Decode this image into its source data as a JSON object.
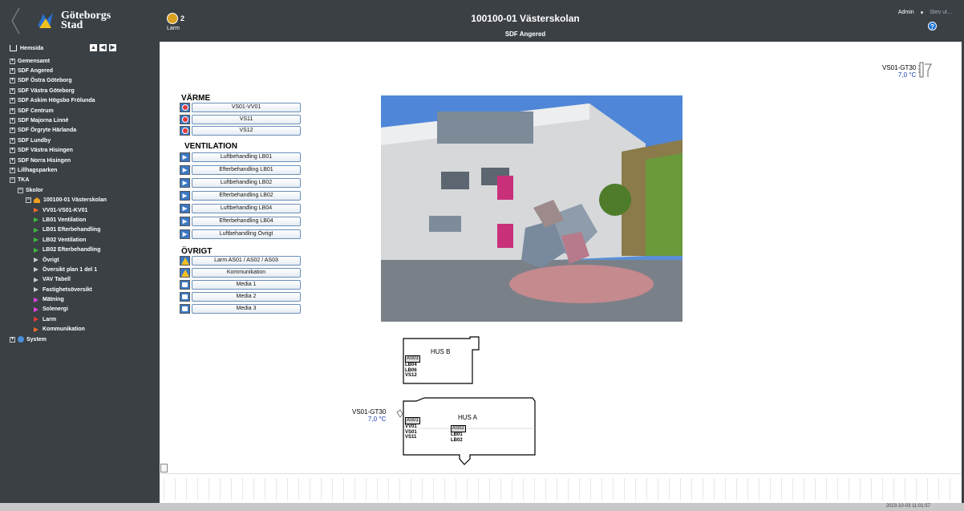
{
  "header": {
    "logo_line1": "Göteborgs",
    "logo_line2": "Stad",
    "alarm_count": "2",
    "alarm_label": "Larm",
    "title": "100100-01 Västerskolan",
    "subtitle": "SDF Angered",
    "user": "Admin",
    "logout": "Stev ut…"
  },
  "sidebar": {
    "home_label": "Hemsida",
    "tree": [
      {
        "label": "Gemensamt",
        "kind": "pm",
        "indent": 0
      },
      {
        "label": "SDF Angered",
        "kind": "pm",
        "indent": 0
      },
      {
        "label": "SDF Östra Göteborg",
        "kind": "pm",
        "indent": 0
      },
      {
        "label": "SDF Västra Göteborg",
        "kind": "pm",
        "indent": 0
      },
      {
        "label": "SDF Askim Högsbo Frölunda",
        "kind": "pm",
        "indent": 0
      },
      {
        "label": "SDF Centrum",
        "kind": "pm",
        "indent": 0
      },
      {
        "label": "SDF Majorna Linné",
        "kind": "pm",
        "indent": 0
      },
      {
        "label": "SDF Örgryte Härlanda",
        "kind": "pm",
        "indent": 0
      },
      {
        "label": "SDF Lundby",
        "kind": "pm",
        "indent": 0
      },
      {
        "label": "SDF Västra Hisingen",
        "kind": "pm",
        "indent": 0
      },
      {
        "label": "SDF Norra Hisingen",
        "kind": "pm",
        "indent": 0
      },
      {
        "label": "Lillhagsparken",
        "kind": "pm",
        "indent": 0
      },
      {
        "label": "TKA",
        "kind": "pm",
        "indent": 0
      },
      {
        "label": "Skolor",
        "kind": "pm",
        "indent": 1
      },
      {
        "label": "100100-01 Västerskolan",
        "kind": "bld",
        "indent": 2
      },
      {
        "label": "VV01-VS01-KV01",
        "kind": "tri",
        "color": "#f06a2a",
        "indent": 3
      },
      {
        "label": "LB01 Ventilation",
        "kind": "tri",
        "color": "#3dbb3d",
        "indent": 3
      },
      {
        "label": "LB01 Efterbehandling",
        "kind": "tri",
        "color": "#3dbb3d",
        "indent": 3
      },
      {
        "label": "LB02 Ventilation",
        "kind": "tri",
        "color": "#3dbb3d",
        "indent": 3
      },
      {
        "label": "LB02 Efterbehandling",
        "kind": "tri",
        "color": "#3dbb3d",
        "indent": 3
      },
      {
        "label": "Övrigt",
        "kind": "tri",
        "color": "#cccccc",
        "indent": 3
      },
      {
        "label": "Översikt plan 1 del 1",
        "kind": "tri",
        "color": "#cccccc",
        "indent": 3
      },
      {
        "label": "VAV Tabell",
        "kind": "tri",
        "color": "#cccccc",
        "indent": 3
      },
      {
        "label": "Fastighetsöversikt",
        "kind": "tri",
        "color": "#cccccc",
        "indent": 3
      },
      {
        "label": "Mätning",
        "kind": "tri",
        "color": "#e040e0",
        "indent": 3
      },
      {
        "label": "Solenergi",
        "kind": "tri",
        "color": "#e040e0",
        "indent": 3
      },
      {
        "label": "Larm",
        "kind": "tri",
        "color": "#e83a3a",
        "indent": 3
      },
      {
        "label": "Kommunikation",
        "kind": "tri",
        "color": "#f06a2a",
        "indent": 3
      },
      {
        "label": "System",
        "kind": "sys",
        "indent": 0
      }
    ]
  },
  "main": {
    "varme_title": "VÄRME",
    "varme_buttons": [
      "VS01-VV01",
      "VS11",
      "VS12"
    ],
    "vent_title": "VENTILATION",
    "vent_buttons": [
      "Luftbehandling LB01",
      "Efterbehandling LB01",
      "Luftbehandling LB02",
      "Efterbehandling LB02",
      "Luftbehandling LB04",
      "Efterbehandling LB04",
      "Luftbehandling Övrigt"
    ],
    "ovrigt_title": "ÖVRIGT",
    "ovrigt_buttons": [
      "Larm AS01 / AS02 / AS03",
      "Kommunikation",
      "Media 1",
      "Media 2",
      "Media 3"
    ],
    "gt_top_name": "VS01-GT30",
    "gt_top_value": "7,0 °C",
    "gt_side_name": "VS01-GT30",
    "gt_side_value": "7,0 °C",
    "hus_b": "HUS B",
    "hus_b_as": "AS03",
    "hus_b_tags": [
      "LB04",
      "LB06",
      "VS12"
    ],
    "hus_a": "HUS A",
    "hus_a_as1": "AS01",
    "hus_a_tags1": [
      "VV01",
      "VS01",
      "VS11"
    ],
    "hus_a_as2": "AS02",
    "hus_a_tags2": [
      "LB01",
      "LB02"
    ]
  },
  "status": {
    "timestamp": "2023-10-03 11:01:57"
  }
}
